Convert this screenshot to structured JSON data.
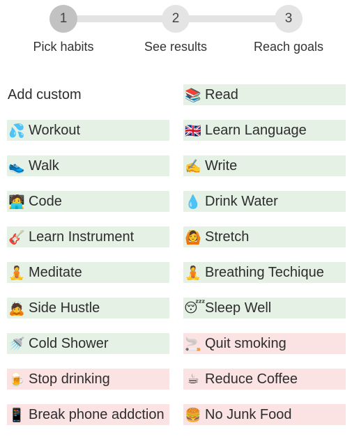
{
  "steps": [
    {
      "number": "1",
      "label": "Pick habits"
    },
    {
      "number": "2",
      "label": "See results"
    },
    {
      "number": "3",
      "label": "Reach goals"
    }
  ],
  "custom": {
    "label": "Add custom"
  },
  "habits": [
    {
      "emoji": "📚",
      "icon": "books-icon",
      "label": "Read",
      "kind": "good"
    },
    {
      "emoji": "💦",
      "icon": "sweat-droplets-icon",
      "label": "Workout",
      "kind": "good"
    },
    {
      "emoji": "🇬🇧",
      "icon": "uk-flag-icon",
      "label": "Learn Language",
      "kind": "good"
    },
    {
      "emoji": "👟",
      "icon": "sneaker-icon",
      "label": "Walk",
      "kind": "good"
    },
    {
      "emoji": "✍️",
      "icon": "writing-hand-icon",
      "label": "Write",
      "kind": "good"
    },
    {
      "emoji": "🧑‍💻",
      "icon": "technologist-icon",
      "label": "Code",
      "kind": "good"
    },
    {
      "emoji": "💧",
      "icon": "droplet-icon",
      "label": "Drink Water",
      "kind": "good"
    },
    {
      "emoji": "🎸",
      "icon": "guitar-icon",
      "label": "Learn Instrument",
      "kind": "good"
    },
    {
      "emoji": "🙆",
      "icon": "person-gesturing-ok-icon",
      "label": "Stretch",
      "kind": "good"
    },
    {
      "emoji": "🧘",
      "icon": "person-meditating-icon",
      "label": "Meditate",
      "kind": "good"
    },
    {
      "emoji": "🧘",
      "icon": "person-lotus-icon",
      "label": "Breathing Techique",
      "kind": "good"
    },
    {
      "emoji": "🙇",
      "icon": "person-bowing-icon",
      "label": "Side Hustle",
      "kind": "good"
    },
    {
      "emoji": "😴",
      "icon": "sleeping-face-icon",
      "label": "Sleep Well",
      "kind": "good"
    },
    {
      "emoji": "🚿",
      "icon": "shower-icon",
      "label": "Cold Shower",
      "kind": "good"
    },
    {
      "emoji": "🚬",
      "icon": "cigarette-icon",
      "label": "Quit smoking",
      "kind": "bad"
    },
    {
      "emoji": "🍺",
      "icon": "beer-mug-icon",
      "label": "Stop drinking",
      "kind": "bad"
    },
    {
      "emoji": "☕",
      "icon": "coffee-icon",
      "label": "Reduce Coffee",
      "kind": "bad"
    },
    {
      "emoji": "📱",
      "icon": "mobile-phone-icon",
      "label": "Break phone addction",
      "kind": "bad"
    },
    {
      "emoji": "🍔",
      "icon": "hamburger-icon",
      "label": "No Junk Food",
      "kind": "bad"
    }
  ],
  "colors": {
    "good_bg": "#e5f1e5",
    "bad_bg": "#fbe3e3",
    "active_step": "#c2c2c2",
    "step": "#e4e4e4",
    "track": "#e3e3e3"
  }
}
